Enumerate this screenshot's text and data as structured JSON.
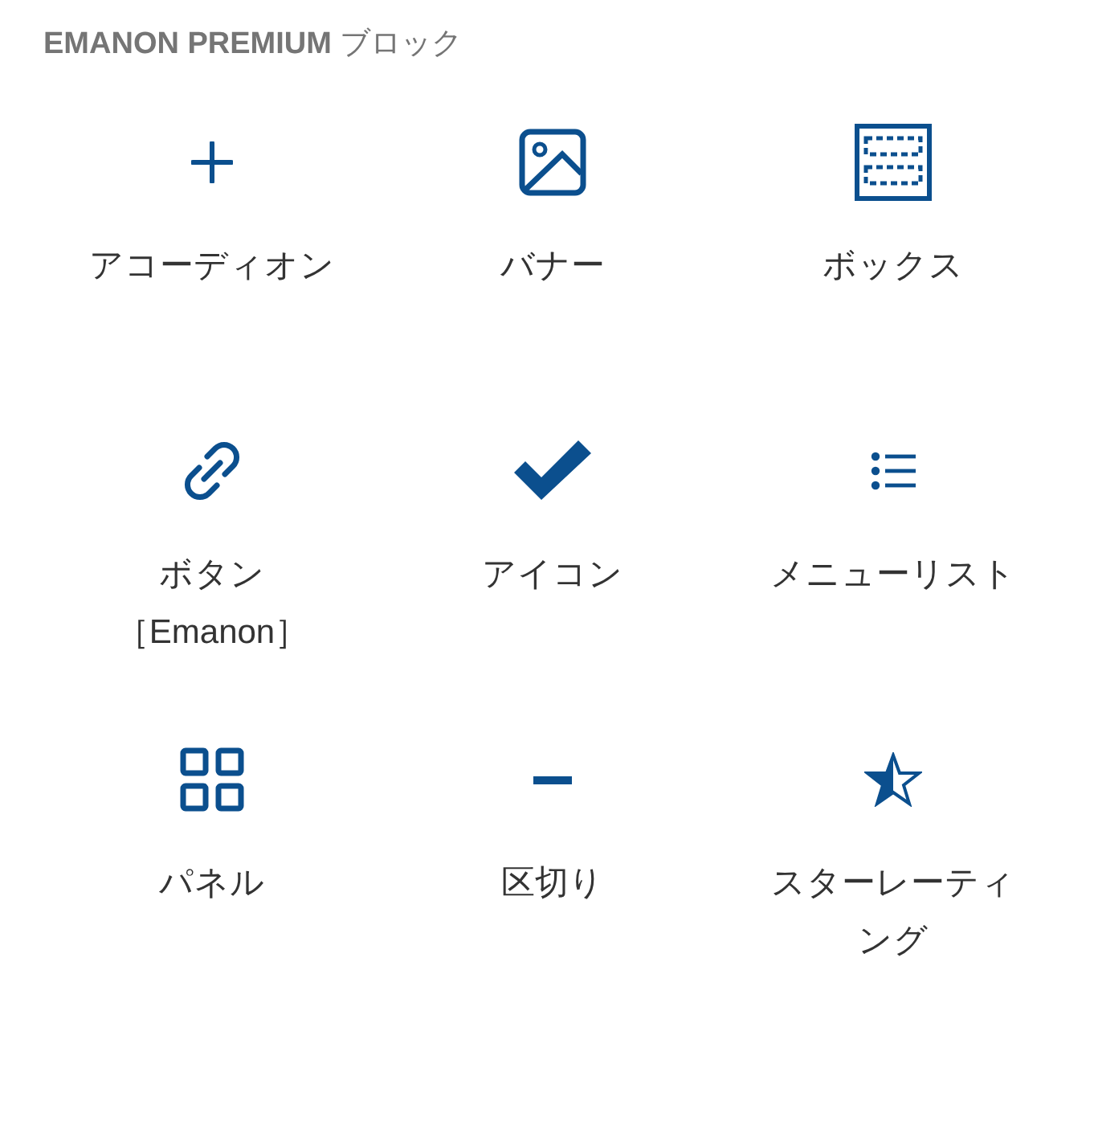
{
  "panel": {
    "title": "**EMANON PREMIUM** ブロック"
  },
  "blocks": [
    {
      "kind": "plus",
      "label": "アコーディオン"
    },
    {
      "kind": "image",
      "label": "バナー"
    },
    {
      "kind": "box",
      "label": "ボックス"
    },
    {
      "kind": "link",
      "label": "ボタン［Emanon］"
    },
    {
      "kind": "check",
      "label": "アイコン"
    },
    {
      "kind": "list",
      "label": "メニューリスト"
    },
    {
      "kind": "grid",
      "label": "パネル"
    },
    {
      "kind": "minus",
      "label": "区切り"
    },
    {
      "kind": "star",
      "label": "スターレーティング"
    }
  ]
}
